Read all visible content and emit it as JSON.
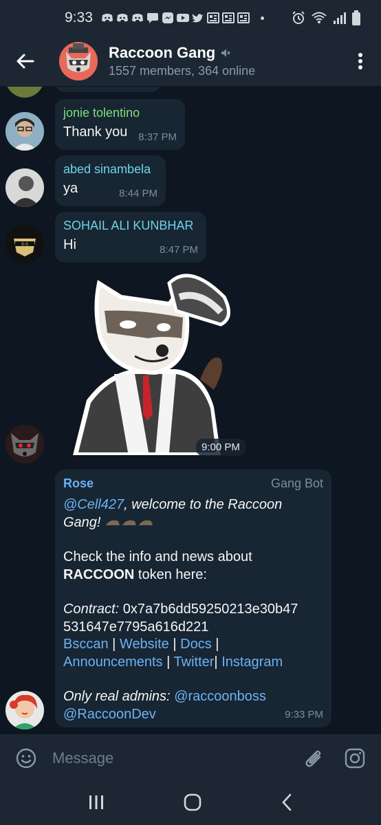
{
  "status_bar": {
    "time": "9:33"
  },
  "header": {
    "title": "Raccoon Gang",
    "subtitle": "1557 members, 364 online"
  },
  "messages": [
    {
      "sender": "jonie tolentino",
      "sender_color": "#7ee07a",
      "text": "Thank you",
      "time": "8:37 PM"
    },
    {
      "sender": "abed sinambela",
      "sender_color": "#6fd3e8",
      "text": "ya",
      "time": "8:44 PM"
    },
    {
      "sender": "SOHAIL ALI KUNBHAR",
      "sender_color": "#6fd3e8",
      "text": "Hi",
      "time": "8:47 PM"
    }
  ],
  "sticker": {
    "time": "9:00 PM"
  },
  "rose_message": {
    "sender": "Rose",
    "role": "Gang Bot",
    "mention": "@Cell427",
    "welcome": ", welcome to the Raccoon Gang!",
    "info_line1": "Check the info and news about",
    "token": "RACCOON",
    "info_line2": " token here:",
    "contract_label": "Contract:",
    "contract_address_1": " 0x7a7b6dd59250213e30b47",
    "contract_address_2": "531647e7795a616d221",
    "links": [
      "Bsccan",
      "Website",
      "Docs",
      "Announcements",
      "Twitter",
      "Instagram"
    ],
    "admins_label": "Only real admins:",
    "admin1": "@raccoonboss",
    "admin2": "@RaccoonDev",
    "time": "9:33 PM"
  },
  "input": {
    "placeholder": "Message"
  },
  "colors": {
    "accent": "#6ab3f3",
    "bubble": "#182533",
    "background": "#0e1621",
    "bar": "#1c2733"
  }
}
